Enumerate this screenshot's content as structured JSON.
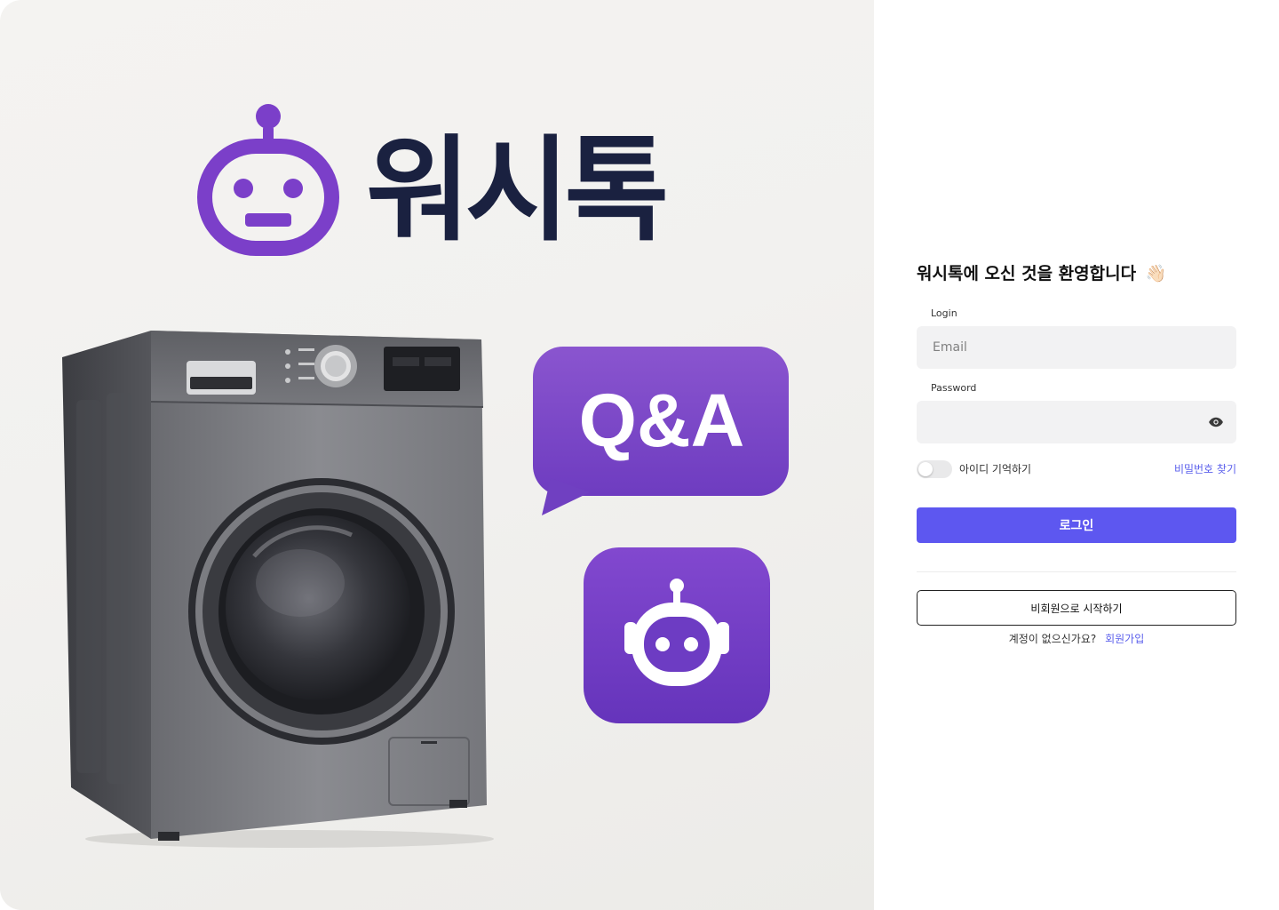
{
  "hero": {
    "brand_name": "워시톡",
    "qa_label": "Q&A",
    "icons": [
      "robot-logo-icon",
      "washing-machine-illustration",
      "chat-bubble-icon",
      "robot-app-icon"
    ]
  },
  "login": {
    "welcome": "워시톡에 오신 것을 환영합니다",
    "welcome_emoji": "👋🏻",
    "email_label": "Login",
    "email_placeholder": "Email",
    "password_label": "Password",
    "password_value": "",
    "remember_label": "아이디 기억하기",
    "remember_checked": false,
    "forgot_label": "비밀번호 찾기",
    "login_button": "로그인",
    "guest_button": "비회원으로 시작하기",
    "no_account_text": "계정이 없으신가요?",
    "signup_link": "회원가입"
  },
  "colors": {
    "brand_purple": "#7b3fc9",
    "primary_button": "#5d57f0",
    "link": "#5b5fec",
    "brand_text": "#1a2140"
  }
}
